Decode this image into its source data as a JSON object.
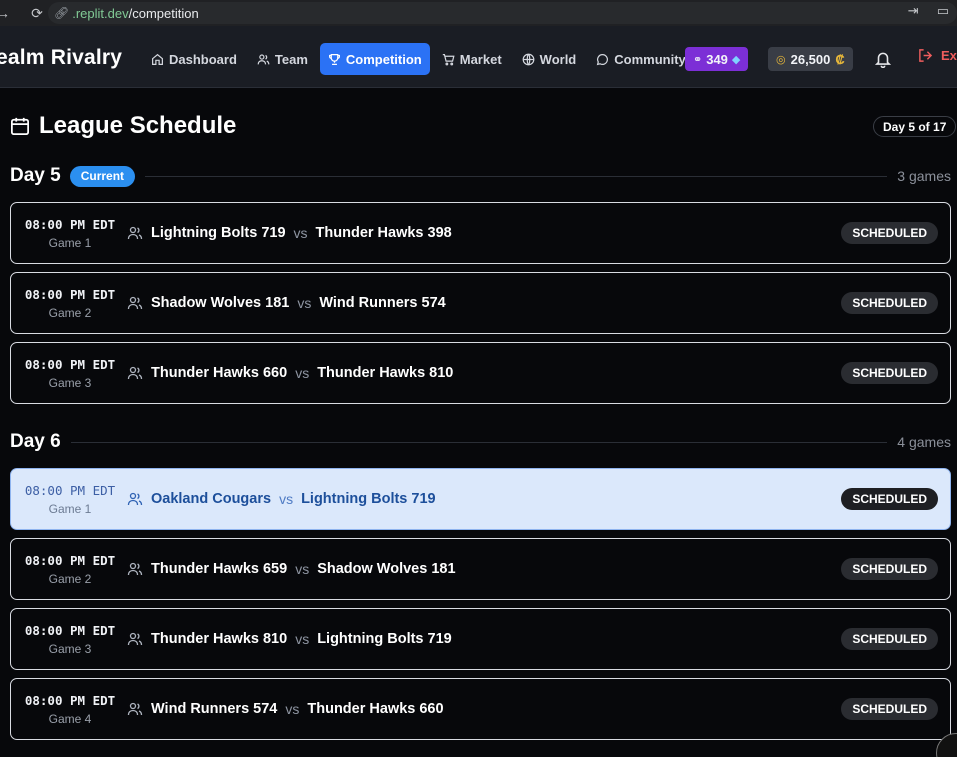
{
  "browser": {
    "url_host_green": ".replit.dev",
    "url_path": "/competition"
  },
  "header": {
    "brand": "ealm Rivalry",
    "nav": [
      {
        "label": "Dashboard",
        "icon": "home-icon"
      },
      {
        "label": "Team",
        "icon": "users-icon"
      },
      {
        "label": "Competition",
        "icon": "trophy-icon",
        "active": true
      },
      {
        "label": "Market",
        "icon": "cart-icon"
      },
      {
        "label": "World",
        "icon": "globe-icon"
      },
      {
        "label": "Community",
        "icon": "chat-icon"
      }
    ],
    "gems": "349",
    "coins": "26,500",
    "coin_symbol": "₡",
    "exit_label": "Ex"
  },
  "schedule": {
    "title": "League Schedule",
    "day_pill": "Day 5 of 17",
    "days": [
      {
        "label": "Day 5",
        "badge": "Current",
        "count": "3 games",
        "games": [
          {
            "time": "08:00 PM EDT",
            "game": "Game 1",
            "home": "Lightning Bolts 719",
            "vs": "vs",
            "away": "Thunder Hawks 398",
            "status": "SCHEDULED"
          },
          {
            "time": "08:00 PM EDT",
            "game": "Game 2",
            "home": "Shadow Wolves 181",
            "vs": "vs",
            "away": "Wind Runners 574",
            "status": "SCHEDULED"
          },
          {
            "time": "08:00 PM EDT",
            "game": "Game 3",
            "home": "Thunder Hawks 660",
            "vs": "vs",
            "away": "Thunder Hawks 810",
            "status": "SCHEDULED"
          }
        ]
      },
      {
        "label": "Day 6",
        "badge": "",
        "count": "4 games",
        "games": [
          {
            "time": "08:00 PM EDT",
            "game": "Game 1",
            "home": "Oakland Cougars",
            "vs": "vs",
            "away": "Lightning Bolts 719",
            "status": "SCHEDULED",
            "highlight": true
          },
          {
            "time": "08:00 PM EDT",
            "game": "Game 2",
            "home": "Thunder Hawks 659",
            "vs": "vs",
            "away": "Shadow Wolves 181",
            "status": "SCHEDULED"
          },
          {
            "time": "08:00 PM EDT",
            "game": "Game 3",
            "home": "Thunder Hawks 810",
            "vs": "vs",
            "away": "Lightning Bolts 719",
            "status": "SCHEDULED"
          },
          {
            "time": "08:00 PM EDT",
            "game": "Game 4",
            "home": "Wind Runners 574",
            "vs": "vs",
            "away": "Thunder Hawks 660",
            "status": "SCHEDULED"
          }
        ]
      }
    ]
  }
}
